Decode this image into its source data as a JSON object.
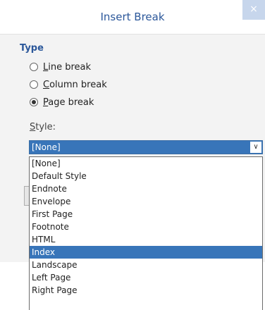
{
  "dialog": {
    "title": "Insert Break",
    "close_label": "×"
  },
  "type_section": {
    "label": "Type",
    "options": [
      {
        "accel": "L",
        "rest": "ine break",
        "checked": false
      },
      {
        "accel": "C",
        "rest": "olumn break",
        "checked": false
      },
      {
        "accel": "P",
        "rest": "age break",
        "checked": true
      }
    ]
  },
  "style_section": {
    "label_accel": "S",
    "label_rest": "tyle:",
    "selected_value": "[None]",
    "arrow_icon": "chevron-down-icon",
    "options": [
      "[None]",
      "Default Style",
      "Endnote",
      "Envelope",
      "First Page",
      "Footnote",
      "HTML",
      "Index",
      "Landscape",
      "Left Page",
      "Right Page"
    ],
    "highlighted_option": "Index"
  },
  "colors": {
    "title": "#2b579a",
    "selection": "#3875b9",
    "panel": "#f3f3f3"
  }
}
